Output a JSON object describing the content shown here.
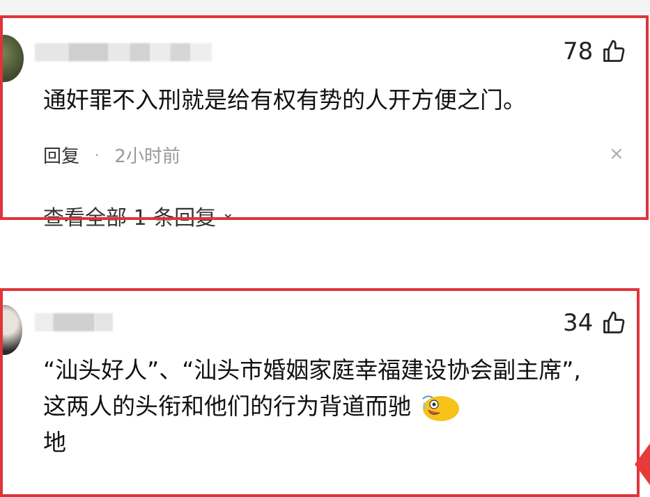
{
  "comments": [
    {
      "likes": "78",
      "text": "通奸罪不入刑就是给有权有势的人开方便之门。",
      "reply_label": "回复",
      "separator": "·",
      "time": "2小时前",
      "close_glyph": "×",
      "view_replies": "查看全部 1 条回复",
      "view_replies_chevron": "⌄"
    },
    {
      "likes": "34",
      "text_line1": "“汕头好人”、“汕头市婚姻家庭幸福建设协会副主席”,",
      "text_line2": "这两人的头衔和他们的行为背道而驰",
      "text_line3": "地"
    }
  ],
  "icons": {
    "like": "thumbs-up-icon",
    "emoji": "crying-laughing-emoji-icon"
  },
  "colors": {
    "highlight_border": "#e0333d",
    "text": "#111111",
    "secondary_text": "#999999"
  }
}
